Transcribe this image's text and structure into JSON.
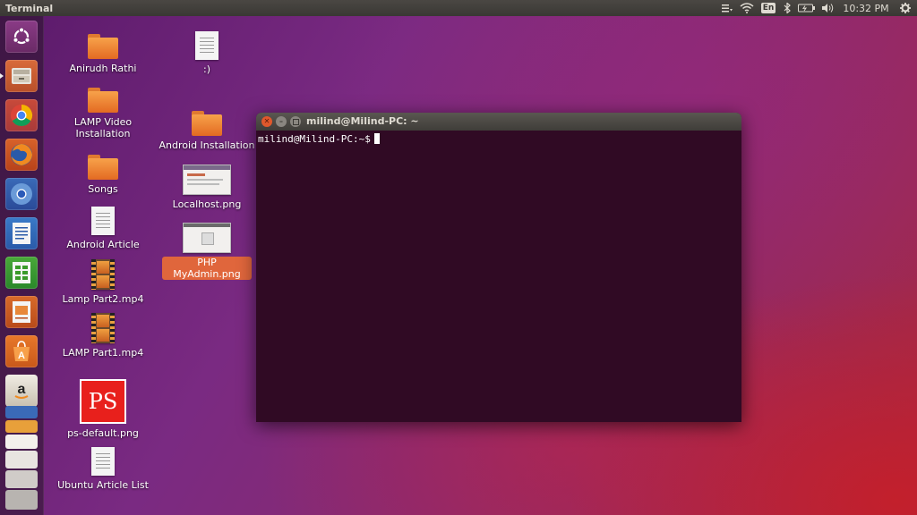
{
  "top_panel": {
    "app_title": "Terminal",
    "keyboard_layout": "En",
    "clock": "10:32 PM",
    "icons": [
      "menu-icon",
      "wifi-icon",
      "keyboard-icon",
      "bluetooth-icon",
      "battery-icon",
      "volume-icon",
      "gear-icon"
    ]
  },
  "launcher": {
    "items": [
      {
        "name": "dash-home",
        "icon": "ubuntu-logo-icon"
      },
      {
        "name": "files",
        "icon": "files-icon"
      },
      {
        "name": "chrome",
        "icon": "chrome-icon"
      },
      {
        "name": "firefox",
        "icon": "firefox-icon"
      },
      {
        "name": "chromium",
        "icon": "chromium-icon"
      },
      {
        "name": "writer",
        "icon": "writer-icon"
      },
      {
        "name": "calc",
        "icon": "calc-icon"
      },
      {
        "name": "impress",
        "icon": "impress-icon"
      },
      {
        "name": "software-center",
        "icon": "software-center-icon"
      },
      {
        "name": "amazon",
        "icon": "amazon-icon"
      }
    ]
  },
  "desktop": {
    "icons": [
      {
        "label": "Anirudh Rathi",
        "type": "folder"
      },
      {
        "label": "LAMP Video\nInstallation",
        "type": "folder"
      },
      {
        "label": "Songs",
        "type": "folder"
      },
      {
        "label": "Android Article",
        "type": "document"
      },
      {
        "label": "Lamp Part2.mp4",
        "type": "video"
      },
      {
        "label": "LAMP Part1.mp4",
        "type": "video"
      },
      {
        "label": "ps-default.png",
        "type": "image",
        "glyph": "PS"
      },
      {
        "label": "Ubuntu Article List",
        "type": "document"
      },
      {
        "label": ":)",
        "type": "document"
      },
      {
        "label": "Android Installation",
        "type": "folder"
      },
      {
        "label": "Localhost.png",
        "type": "image"
      },
      {
        "label": "PHP MyAdmin.png",
        "type": "image",
        "selected": true
      }
    ]
  },
  "terminal": {
    "title": "milind@Milind-PC: ~",
    "prompt": "milind@Milind-PC:~$"
  },
  "colors": {
    "terminal_bg": "#300a24",
    "selection": "#e0663c",
    "close_button": "#e0582c"
  }
}
